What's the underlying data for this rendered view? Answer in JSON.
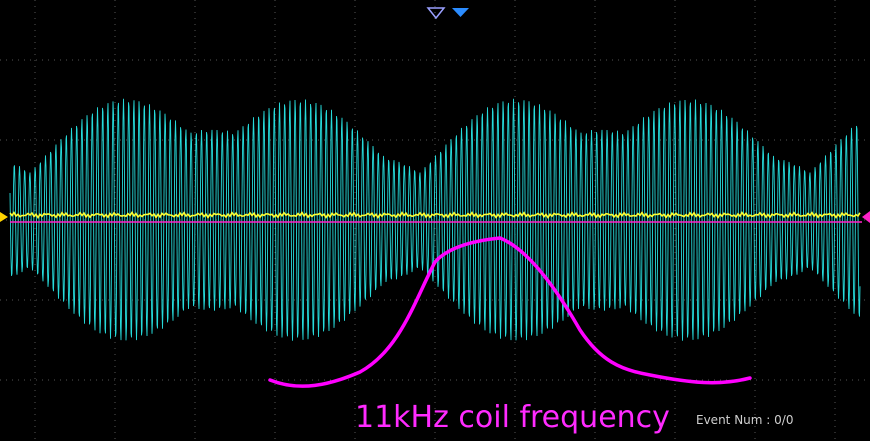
{
  "screen": {
    "annotation_text": "11kHz coil frequency",
    "event_label": "Event Num :",
    "event_value": "0/0"
  },
  "colors": {
    "background": "#000000",
    "grid": "#555555",
    "ch1": "#28e6e6",
    "ch2": "#ffff33",
    "ch3": "#ff22c8",
    "annotation": "#ff2bff",
    "trigger_marker": "#2b8cff"
  },
  "markers": {
    "trigger_position_icon": "hollow-down-triangle",
    "horizontal_position_icon": "filled-down-triangle",
    "ch2_ground_icon": "yellow-right-triangle",
    "ch3_level_icon": "pink-left-triangle"
  }
}
